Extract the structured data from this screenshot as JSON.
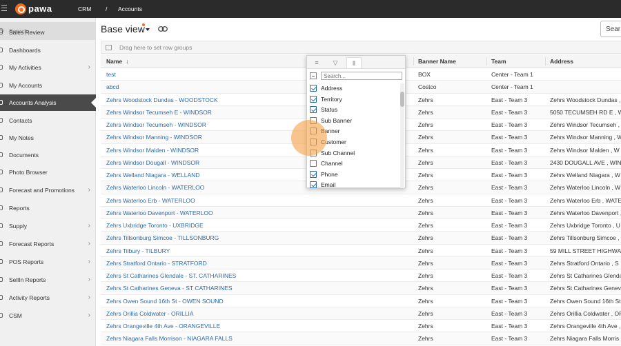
{
  "topbar": {
    "brand": "pawa",
    "crumbs": [
      "CRM",
      "/",
      "Accounts"
    ]
  },
  "sidebar": {
    "search_placeholder": "Search...",
    "items": [
      {
        "label": "Sales Review",
        "chevron": false
      },
      {
        "label": "Dashboards",
        "chevron": false
      },
      {
        "label": "My Activities",
        "chevron": true
      },
      {
        "label": "My Accounts",
        "chevron": false
      },
      {
        "label": "Accounts Analysis",
        "chevron": false,
        "active": true
      },
      {
        "label": "Contacts",
        "chevron": false
      },
      {
        "label": "My Notes",
        "chevron": false
      },
      {
        "label": "Documents",
        "chevron": false
      },
      {
        "label": "Photo Browser",
        "chevron": false
      },
      {
        "label": "Forecast and Promotions",
        "chevron": true
      },
      {
        "label": "Reports",
        "chevron": false
      },
      {
        "label": "Supply",
        "chevron": true
      },
      {
        "label": "Forecast Reports",
        "chevron": true
      },
      {
        "label": "POS Reports",
        "chevron": true
      },
      {
        "label": "SellIn Reports",
        "chevron": true
      },
      {
        "label": "Activity Reports",
        "chevron": true
      },
      {
        "label": "CSM",
        "chevron": true
      }
    ]
  },
  "main": {
    "view_title": "Base view",
    "search_button": "Sear",
    "group_bar_text": "Drag here to set row groups",
    "columns": {
      "name": "Name",
      "sort_arrow": "↓",
      "banner": "Banner Name",
      "team": "Team",
      "address": "Address"
    },
    "rows": [
      {
        "name": "test",
        "banner": "BOX",
        "team": "Center - Team 1",
        "address": ""
      },
      {
        "name": "abcd",
        "banner": "Costco",
        "team": "Center - Team 1",
        "address": ""
      },
      {
        "name": "Zehrs Woodstock Dundas - WOODSTOCK",
        "banner": "Zehrs",
        "team": "East - Team 3",
        "address": "Zehrs Woodstock Dundas ,"
      },
      {
        "name": "Zehrs Windsor Tecumseh E - WINDSOR",
        "banner": "Zehrs",
        "team": "East - Team 3",
        "address": "5050 TECUMSEH RD E , W"
      },
      {
        "name": "Zehrs Windsor Tecumseh - WINDSOR",
        "banner": "Zehrs",
        "team": "East - Team 3",
        "address": "Zehrs Windsor Tecumseh ,"
      },
      {
        "name": "Zehrs Windsor Manning - WINDSOR",
        "banner": "Zehrs",
        "team": "East - Team 3",
        "address": "Zehrs Windsor Manning , W"
      },
      {
        "name": "Zehrs Windsor Malden - WINDSOR",
        "banner": "Zehrs",
        "team": "East - Team 3",
        "address": "Zehrs Windsor Malden , W"
      },
      {
        "name": "Zehrs Windsor Dougall - WINDSOR",
        "banner": "Zehrs",
        "team": "East - Team 3",
        "address": "2430 DOUGALL AVE , WIN"
      },
      {
        "name": "Zehrs Welland Niagara - WELLAND",
        "banner": "Zehrs",
        "team": "East - Team 3",
        "address": "Zehrs Welland Niagara , W"
      },
      {
        "name": "Zehrs Waterloo Lincoln - WATERLOO",
        "banner": "Zehrs",
        "team": "East - Team 3",
        "address": "Zehrs Waterloo Lincoln , W"
      },
      {
        "name": "Zehrs Waterloo Erb - WATERLOO",
        "banner": "Zehrs",
        "team": "East - Team 3",
        "address": "Zehrs Waterloo Erb , WATE"
      },
      {
        "name": "Zehrs Waterloo Davenport - WATERLOO",
        "banner": "Zehrs",
        "team": "East - Team 3",
        "address": "Zehrs Waterloo Davenport ,"
      },
      {
        "name": "Zehrs Uxbridge Toronto - UXBRIDGE",
        "banner": "Zehrs",
        "team": "East - Team 3",
        "address": "Zehrs Uxbridge Toronto , U"
      },
      {
        "name": "Zehrs Tillsonburg Simcoe - TILLSONBURG",
        "banner": "Zehrs",
        "team": "East - Team 3",
        "address": "Zehrs Tillsonburg Simcoe ,"
      },
      {
        "name": "Zehrs Tilbury - TILBURY",
        "banner": "Zehrs",
        "team": "East - Team 3",
        "address": "59 MILL STREET HIGHWA"
      },
      {
        "name": "Zehrs Stratford Ontario - STRATFORD",
        "banner": "Zehrs",
        "team": "East - Team 3",
        "address": "Zehrs Stratford Ontario , S"
      },
      {
        "name": "Zehrs St Catharines Glendale - ST. CATHARINES",
        "banner": "Zehrs",
        "team": "East - Team 3",
        "address": "Zehrs St Catharines Glenda"
      },
      {
        "name": "Zehrs St Catharines Geneva - ST CATHARINES",
        "banner": "Zehrs",
        "team": "East - Team 3",
        "address": "Zehrs St Catharines Genev"
      },
      {
        "name": "Zehrs Owen Sound 16th St - OWEN SOUND",
        "banner": "Zehrs",
        "team": "East - Team 3",
        "address": "Zehrs Owen Sound 16th St"
      },
      {
        "name": "Zehrs Orillia Coldwater - ORILLIA",
        "banner": "Zehrs",
        "team": "East - Team 3",
        "address": "Zehrs Orillia Coldwater , OR"
      },
      {
        "name": "Zehrs Orangeville 4th Ave - ORANGEVILLE",
        "banner": "Zehrs",
        "team": "East - Team 3",
        "address": "Zehrs Orangeville 4th Ave ,"
      },
      {
        "name": "Zehrs Niagara Falls Morrison - NIAGARA FALLS",
        "banner": "Zehrs",
        "team": "East - Team 3",
        "address": "Zehrs Niagara Falls Morris"
      }
    ]
  },
  "column_menu": {
    "tabs": [
      "≡",
      "▽",
      "⦀"
    ],
    "search_placeholder": "Search...",
    "items": [
      {
        "label": "Address",
        "checked": true
      },
      {
        "label": "Territory",
        "checked": true
      },
      {
        "label": "Status",
        "checked": true
      },
      {
        "label": "Sub Banner",
        "checked": false
      },
      {
        "label": "Banner",
        "checked": false
      },
      {
        "label": "Customer",
        "checked": false
      },
      {
        "label": "Sub Channel",
        "checked": false
      },
      {
        "label": "Channel",
        "checked": false
      },
      {
        "label": "Phone",
        "checked": true
      },
      {
        "label": "Email",
        "checked": true
      }
    ]
  },
  "colors": {
    "topbar": "#2b2b2b",
    "brand_accent": "#f26d21",
    "link": "#2d6aa8",
    "sidebar_active": "#4a4a4a",
    "click_highlight": "#f5a046"
  }
}
